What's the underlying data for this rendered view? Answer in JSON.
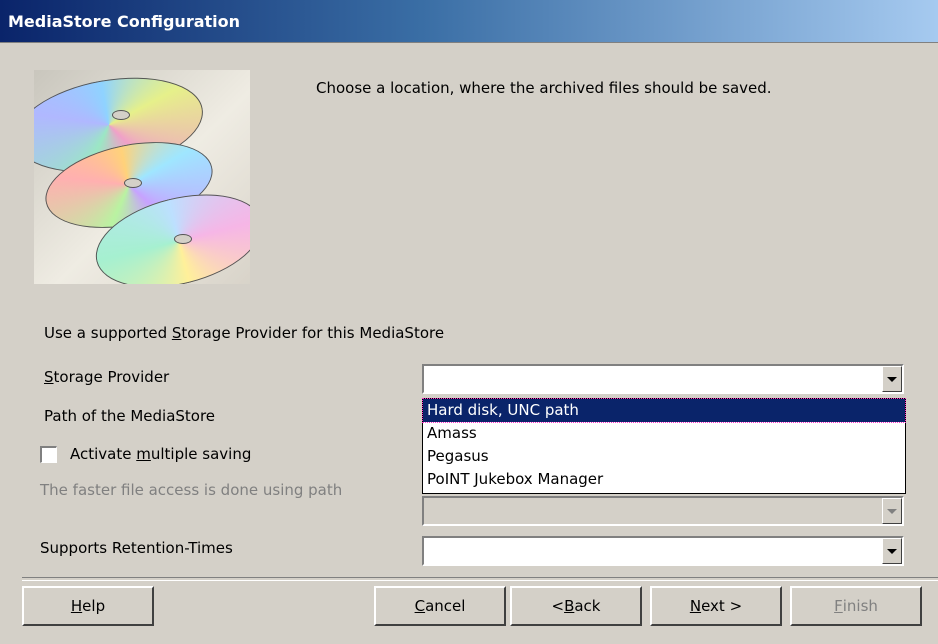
{
  "window": {
    "title": "MediaStore Configuration"
  },
  "intro": {
    "description": "Choose a location, where the archived files should be saved."
  },
  "storage": {
    "group_label_prefix": "Use a supported ",
    "group_label_u": "S",
    "group_label_suffix": "torage Provider for this MediaStore",
    "provider_label_u": "S",
    "provider_label_rest": "torage Provider",
    "provider_value": "",
    "path_label": "Path of the MediaStore",
    "multi_label_prefix": "Activate ",
    "multi_label_u": "m",
    "multi_label_suffix": "ultiple saving",
    "multi_checked": false,
    "fast_label": "The faster file access is done using path",
    "retention_label": "Supports Retention-Times",
    "retention_value": ""
  },
  "dropdown": {
    "options": [
      "Hard disk, UNC path",
      "Amass",
      "Pegasus",
      "PoINT Jukebox Manager"
    ],
    "selected_index": 0
  },
  "buttons": {
    "help_u": "H",
    "help_rest": "elp",
    "cancel_u": "C",
    "cancel_rest": "ancel",
    "back_pre": "< ",
    "back_u": "B",
    "back_rest": "ack",
    "next_u": "N",
    "next_rest": "ext >",
    "finish_u": "F",
    "finish_rest": "inish"
  },
  "icons": {
    "dropdown": "chevron-down-icon",
    "checkbox": "checkbox-icon",
    "illustration": "cd-discs-image"
  }
}
